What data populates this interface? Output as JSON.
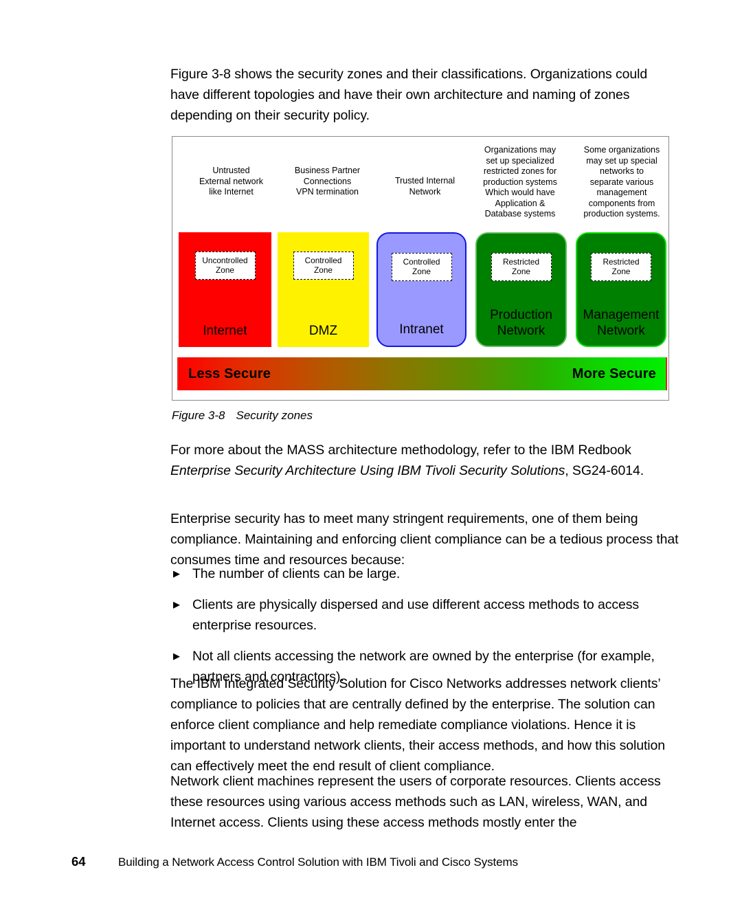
{
  "document": {
    "intro_paragraph": "Figure 3-8 shows the security zones and their classifications. Organizations could have different topologies and have their own architecture and naming of zones depending on their security policy.",
    "mass_paragraph_lead": "For more about the MASS architecture methodology, refer to the IBM Redbook ",
    "mass_paragraph_italic": "Enterprise Security Architecture Using IBM Tivoli Security Solutions",
    "mass_paragraph_tail": ", SG24-6014.",
    "enterprise_paragraph": "Enterprise security has to meet many stringent requirements, one of them being compliance. Maintaining and enforcing client compliance can be a tedious process that consumes time and resources because:",
    "bullet_marker": "▶",
    "bullets": [
      "The number of clients can be large.",
      "Clients are physically dispersed and use different access methods to access enterprise resources.",
      "Not all clients accessing the network are owned by the enterprise (for example, partners and contractors)."
    ],
    "ibm_paragraph": "The IBM Integrated Security Solution for Cisco Networks addresses network clients’ compliance to policies that are centrally defined by the enterprise. The solution can enforce client compliance and help remediate compliance violations. Hence it is important to understand network clients, their access methods, and how this solution can effectively meet the end result of client compliance.",
    "network_clients_paragraph": "Network client machines represent the users of corporate resources. Clients access these resources using various access methods such as LAN, wireless, WAN, and Internet access. Clients using these access methods mostly enter the"
  },
  "figure": {
    "caption_number": "Figure 3-8",
    "caption_text": "Security zones",
    "annotations": [
      "Untrusted External network like Internet",
      "Business Partner Connections VPN termination",
      "Trusted Internal Network",
      "Organizations may set up specialized restricted zones for production systems Which would have Application & Database systems",
      "Some organizations may set up special networks to separate various management components from production systems."
    ],
    "annotation_lines": {
      "untrusted": [
        "Untrusted",
        "External network",
        "like Internet"
      ],
      "partner": [
        "Business Partner",
        "Connections",
        "VPN termination"
      ],
      "trusted": [
        "Trusted Internal",
        "Network"
      ],
      "production": [
        "Organizations may",
        "set up specialized",
        "restricted zones for",
        "production systems",
        "Which would have",
        "Application &",
        "Database systems"
      ],
      "management": [
        "Some organizations",
        "may set up special",
        "networks to",
        "separate various",
        "management",
        "components from",
        "production systems."
      ]
    },
    "zones": [
      {
        "name": "Internet",
        "classification_line1": "Uncontrolled",
        "classification_line2": "Zone",
        "color": "#FF0000"
      },
      {
        "name": "DMZ",
        "classification_line1": "Controlled",
        "classification_line2": "Zone",
        "color": "#FFF200"
      },
      {
        "name": "Intranet",
        "classification_line1": "Controlled",
        "classification_line2": "Zone",
        "color": "#9A99FF",
        "border_color": "#1414E6"
      },
      {
        "name_line1": "Production",
        "name_line2": "Network",
        "classification_line1": "Restricted",
        "classification_line2": "Zone",
        "color": "#008000",
        "border_color": "#5DBE5D"
      },
      {
        "name_line1": "Management",
        "name_line2": "Network",
        "classification_line1": "Restricted",
        "classification_line2": "Zone",
        "color": "#008000",
        "border_color": "#00E000"
      }
    ],
    "gradient": {
      "left_label": "Less Secure",
      "right_label": "More Secure",
      "start_color": "#FF0000",
      "end_color": "#00F000"
    }
  },
  "footer": {
    "page_number": "64",
    "book_title": "Building a Network Access Control Solution with IBM Tivoli and Cisco Systems"
  }
}
